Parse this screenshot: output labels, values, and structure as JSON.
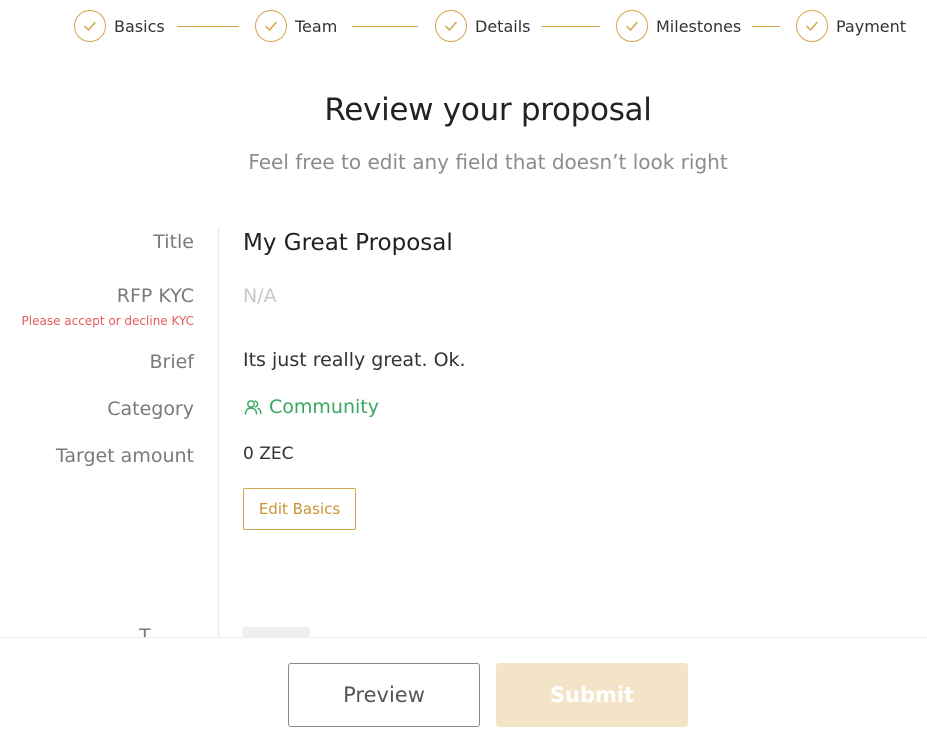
{
  "steps": [
    {
      "label": "Basics"
    },
    {
      "label": "Team"
    },
    {
      "label": "Details"
    },
    {
      "label": "Milestones"
    },
    {
      "label": "Payment"
    }
  ],
  "page": {
    "heading": "Review your proposal",
    "subheading": "Feel free to edit any field that doesn’t look right"
  },
  "basics": {
    "title_label": "Title",
    "title_value": "My Great Proposal",
    "kyc_label": "RFP KYC",
    "kyc_error": "Please accept or decline KYC",
    "kyc_value": "N/A",
    "brief_label": "Brief",
    "brief_value": "Its just really great. Ok.",
    "category_label": "Category",
    "category_value": "Community",
    "category_icon": "community-icon",
    "target_label": "Target amount",
    "target_value": "0 ZEC",
    "edit_button": "Edit Basics"
  },
  "footer": {
    "preview_label": "Preview",
    "submit_label": "Submit"
  },
  "colors": {
    "accent": "#d4a54a",
    "category_green": "#38a760",
    "error": "#e55b5b",
    "submit_disabled": "#f3e4c8"
  }
}
